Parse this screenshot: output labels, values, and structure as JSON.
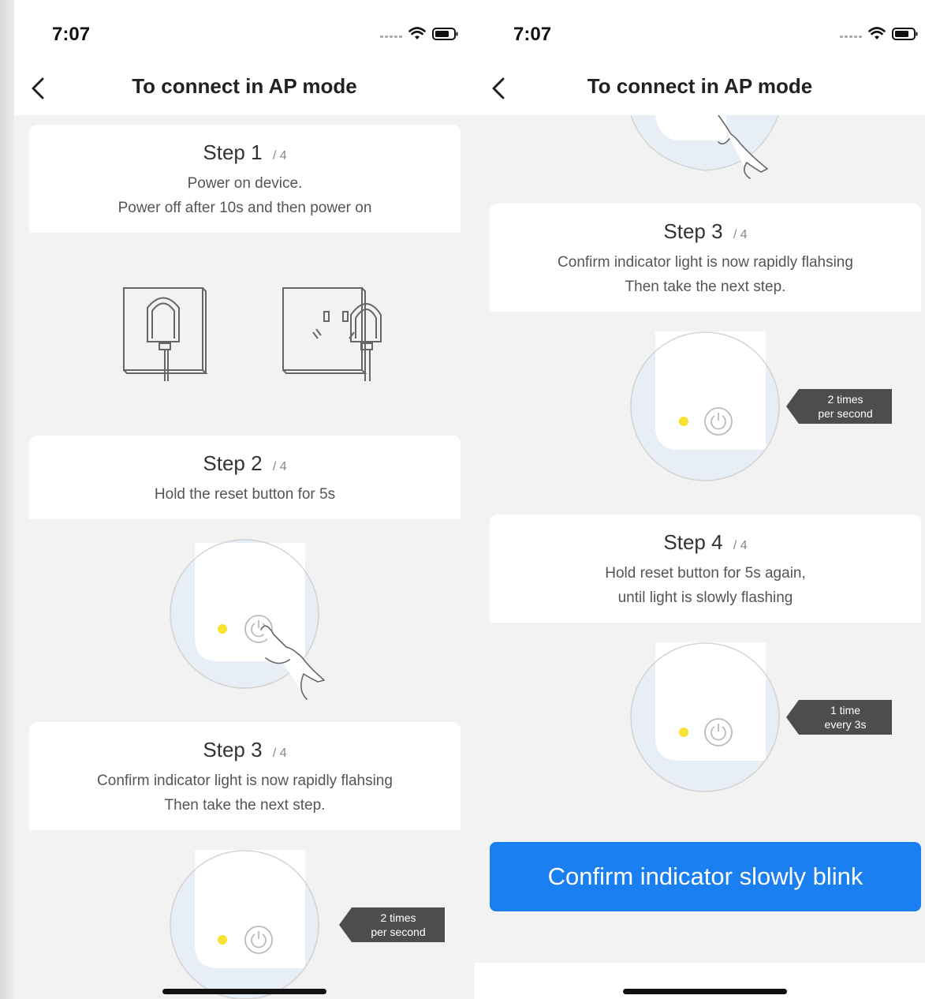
{
  "status": {
    "time": "7:07"
  },
  "nav": {
    "title": "To connect in AP mode"
  },
  "steps": {
    "step1": {
      "word": "Step",
      "number": "1",
      "total": "/ 4",
      "line1": "Power on device.",
      "line2": "Power off after 10s and then power on"
    },
    "step2": {
      "word": "Step",
      "number": "2",
      "total": "/ 4",
      "line1": "Hold the reset button for 5s"
    },
    "step3": {
      "word": "Step",
      "number": "3",
      "total": "/ 4",
      "line1": "Confirm indicator light is now rapidly flahsing",
      "line2": "Then take the next step."
    },
    "step4": {
      "word": "Step",
      "number": "4",
      "total": "/ 4",
      "line1": "Hold reset button for 5s again,",
      "line2": "until light is slowly flashing"
    }
  },
  "badges": {
    "rapid": {
      "line1": "2 times",
      "line2": "per second"
    },
    "slow": {
      "line1": "1 time",
      "line2": "every 3s"
    }
  },
  "actions": {
    "confirm_label": "Confirm indicator slowly blink"
  },
  "colors": {
    "accent": "#1a7ff0",
    "indicator": "#f7e231",
    "badge": "#4d4d4d"
  },
  "icons": [
    "back-chevron-icon",
    "signal-icon",
    "wifi-icon",
    "battery-icon",
    "power-icon",
    "hand-pointer-icon",
    "plug-icon",
    "wall-socket-icon"
  ]
}
